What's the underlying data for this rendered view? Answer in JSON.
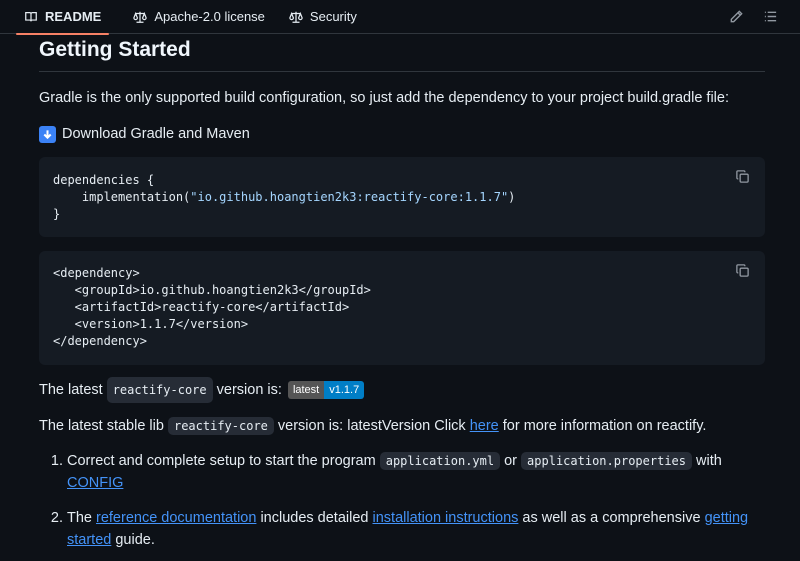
{
  "tabs": {
    "readme": "README",
    "license": "Apache-2.0 license",
    "security": "Security"
  },
  "heading": "Getting Started",
  "intro": "Gradle is the only supported build configuration, so just add the dependency to your project build.gradle file:",
  "download_label": "Download Gradle and Maven",
  "gradle_code": {
    "line1": "dependencies {",
    "line2_prefix": "    implementation(",
    "line2_string": "\"io.github.hoangtien2k3:reactify-core:1.1.7\"",
    "line2_suffix": ")",
    "line3": "}"
  },
  "maven_code": {
    "line1": "<dependency>",
    "line2": "   <groupId>io.github.hoangtien2k3</groupId>",
    "line3": "   <artifactId>reactify-core</artifactId>",
    "line4": "   <version>1.1.7</version>",
    "line5": "</dependency>"
  },
  "latest": {
    "prefix": "The latest ",
    "code": "reactify-core",
    "suffix": " version is:",
    "badge_left": "latest",
    "badge_right": "v1.1.7"
  },
  "stable": {
    "prefix": "The latest stable lib ",
    "code": "reactify-core",
    "middle": " version is: latestVersion Click ",
    "link": "here",
    "suffix": " for more information on reactify."
  },
  "list": [
    {
      "text1": "Correct and complete setup to start the program ",
      "code1": "application.yml",
      "text2": " or ",
      "code2": "application.properties",
      "text3": " with ",
      "link": "CONFIG"
    },
    {
      "text1": "The ",
      "link1": "reference documentation",
      "text2": " includes detailed ",
      "link2": "installation instructions",
      "text3": " as well as a comprehensive ",
      "link3": "getting started",
      "text4": " guide."
    }
  ],
  "colors": {
    "background": "#0d1117",
    "link": "#4493f8",
    "tab_underline": "#f78166",
    "badge_right": "#007ec6"
  }
}
